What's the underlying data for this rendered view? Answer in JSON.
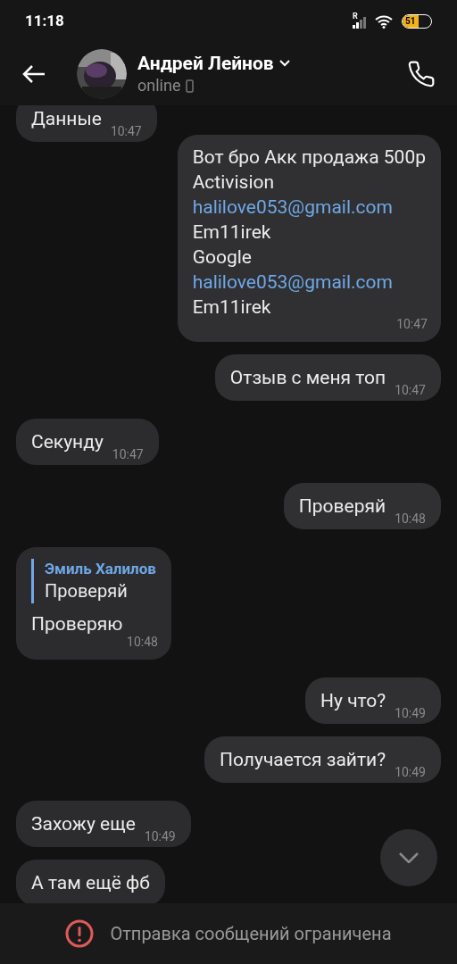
{
  "status_bar": {
    "time": "11:18",
    "signal_label": "R",
    "battery": "51"
  },
  "header": {
    "name": "Андрей Лейнов",
    "status": "online"
  },
  "messages": [
    {
      "outgoing": false,
      "lines": [
        {
          "kind": "text",
          "text": "Данные"
        }
      ],
      "time": "10:47"
    },
    {
      "outgoing": true,
      "lines": [
        {
          "kind": "text",
          "text": "Вот бро Акк продажа 500р"
        },
        {
          "kind": "text",
          "text": "Activision"
        },
        {
          "kind": "link",
          "text": "halilove053@gmail.com"
        },
        {
          "kind": "text",
          "text": "Em11irek"
        },
        {
          "kind": "text",
          "text": "Google"
        },
        {
          "kind": "link",
          "text": "halilove053@gmail.com"
        },
        {
          "kind": "text",
          "text": "Em11irek"
        }
      ],
      "time": "10:47"
    },
    {
      "outgoing": true,
      "lines": [
        {
          "kind": "text",
          "text": "Отзыв с меня топ"
        }
      ],
      "time": "10:47"
    },
    {
      "outgoing": false,
      "lines": [
        {
          "kind": "text",
          "text": "Секунду"
        }
      ],
      "time": "10:47"
    },
    {
      "outgoing": true,
      "lines": [
        {
          "kind": "text",
          "text": "Проверяй"
        }
      ],
      "time": "10:48"
    },
    {
      "outgoing": false,
      "reply": {
        "author": "Эмиль Халилов",
        "text": "Проверяй"
      },
      "lines": [
        {
          "kind": "text",
          "text": "Проверяю"
        }
      ],
      "time": "10:48"
    },
    {
      "outgoing": true,
      "lines": [
        {
          "kind": "text",
          "text": "Ну что?"
        }
      ],
      "time": "10:49"
    },
    {
      "outgoing": true,
      "lines": [
        {
          "kind": "text",
          "text": "Получается зайти?"
        }
      ],
      "time": "10:49"
    },
    {
      "outgoing": false,
      "lines": [
        {
          "kind": "text",
          "text": "Захожу еще"
        }
      ],
      "time": "10:49"
    },
    {
      "outgoing": false,
      "lines": [
        {
          "kind": "text",
          "text": "А там ещё фб"
        }
      ]
    }
  ],
  "notice": "Отправка сообщений ограничена"
}
